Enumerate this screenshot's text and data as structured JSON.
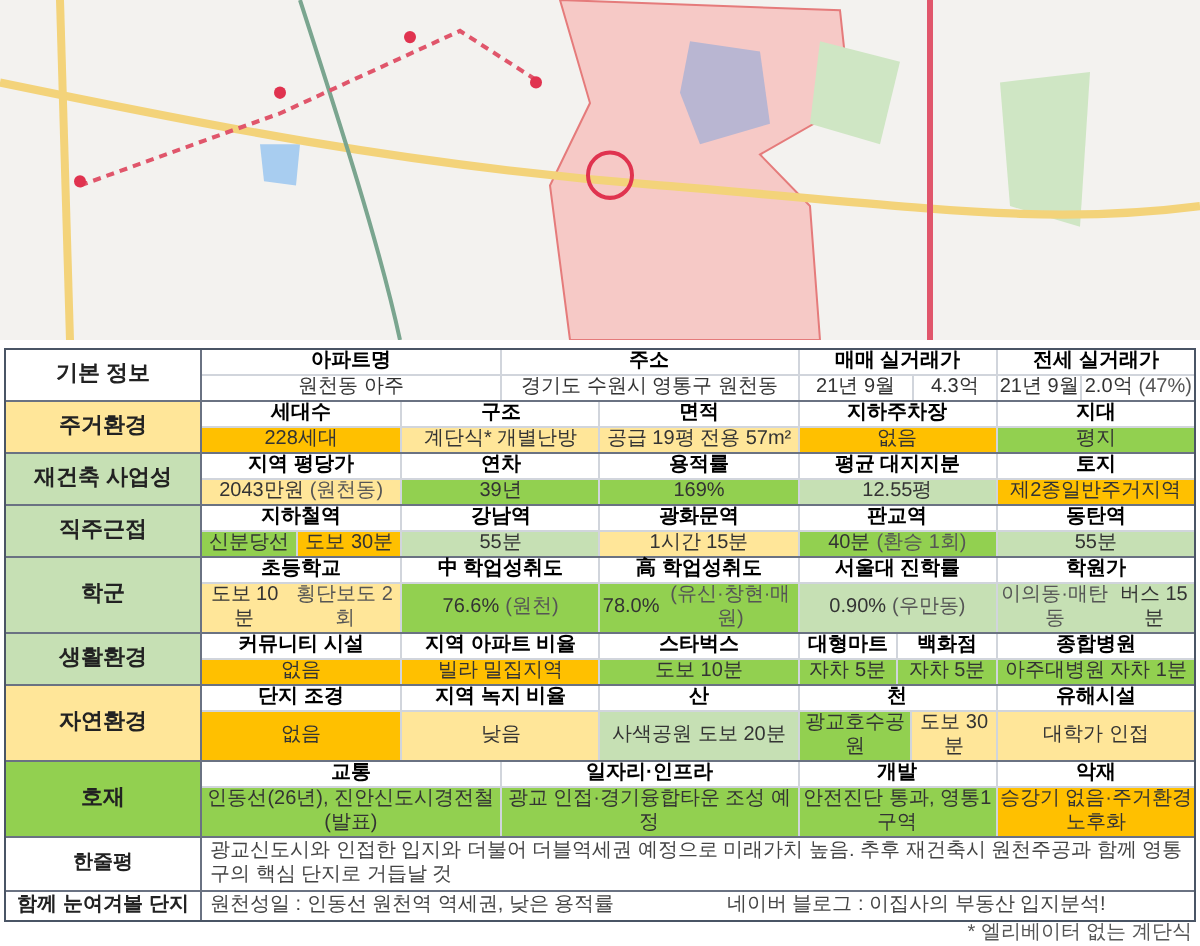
{
  "sections": [
    {
      "label": "기본 정보",
      "color": "#ffffff",
      "cells": [
        {
          "header": "아파트명",
          "values": [
            {
              "text": "원천동 아주",
              "color": "#ffffff"
            }
          ]
        },
        {
          "header": "주소",
          "values": [
            {
              "text": "경기도 수원시 영통구 원천동",
              "color": "#ffffff"
            }
          ]
        },
        {
          "header": "매매 실거래가",
          "values": [
            {
              "text": "21년 9월",
              "color": "#ffffff"
            },
            {
              "text": "4.3억",
              "color": "#ffffff"
            }
          ]
        },
        {
          "header": "전세 실거래가",
          "values": [
            {
              "text": "21년 9월",
              "color": "#ffffff"
            },
            {
              "text": "2.0억",
              "note": "(47%)",
              "color": "#ffffff"
            }
          ]
        }
      ]
    },
    {
      "label": "주거환경",
      "color": "#ffe699",
      "cells": [
        {
          "header": "세대수",
          "values": [
            {
              "text": "228세대",
              "color": "#ffc000"
            }
          ]
        },
        {
          "header": "구조",
          "values": [
            {
              "text": "계단식* 개별난방",
              "color": "#ffe699"
            }
          ]
        },
        {
          "header": "면적",
          "values": [
            {
              "text": "공급 19평 전용 57m²",
              "color": "#ffe699"
            }
          ]
        },
        {
          "header": "지하주차장",
          "values": [
            {
              "text": "없음",
              "color": "#ffc000"
            }
          ]
        },
        {
          "header": "지대",
          "values": [
            {
              "text": "평지",
              "color": "#92d050"
            }
          ]
        }
      ]
    },
    {
      "label": "재건축 사업성",
      "color": "#c6e0b4",
      "cells": [
        {
          "header": "지역 평당가",
          "values": [
            {
              "text": "2043만원",
              "note": "(원천동)",
              "color": "#ffe699"
            }
          ]
        },
        {
          "header": "연차",
          "values": [
            {
              "text": "39년",
              "color": "#92d050"
            }
          ]
        },
        {
          "header": "용적률",
          "values": [
            {
              "text": "169%",
              "color": "#92d050"
            }
          ]
        },
        {
          "header": "평균 대지지분",
          "values": [
            {
              "text": "12.55평",
              "color": "#c6e0b4"
            }
          ]
        },
        {
          "header": "토지",
          "values": [
            {
              "text": "제2종일반주거지역",
              "color": "#ffc000"
            }
          ]
        }
      ]
    },
    {
      "label": "직주근접",
      "color": "#c6e0b4",
      "cells": [
        {
          "header": "지하철역",
          "values": [
            {
              "text": "신분당선",
              "color": "#92d050"
            },
            {
              "text": "도보 30분",
              "color": "#ffc000"
            }
          ]
        },
        {
          "header": "강남역",
          "values": [
            {
              "text": "55분",
              "color": "#c6e0b4"
            }
          ]
        },
        {
          "header": "광화문역",
          "values": [
            {
              "text": "1시간 15분",
              "color": "#ffe699"
            }
          ]
        },
        {
          "header": "판교역",
          "values": [
            {
              "text": "40분",
              "note": "(환승 1회)",
              "color": "#92d050"
            }
          ]
        },
        {
          "header": "동탄역",
          "values": [
            {
              "text": "55분",
              "color": "#c6e0b4"
            }
          ]
        }
      ]
    },
    {
      "label": "학군",
      "color": "#c6e0b4",
      "cells": [
        {
          "header": "초등학교",
          "values": [
            {
              "text": "도보 10분",
              "note": "횡단보도 2회",
              "color": "#ffe699"
            }
          ]
        },
        {
          "header": "中 학업성취도",
          "values": [
            {
              "text": "76.6%",
              "note": "(원천)",
              "color": "#92d050"
            }
          ]
        },
        {
          "header": "高 학업성취도",
          "values": [
            {
              "text": "78.0%",
              "note": "(유신·창현·매원)",
              "color": "#92d050"
            }
          ]
        },
        {
          "header": "서울대 진학률",
          "values": [
            {
              "text": "0.90%",
              "note": "(우만동)",
              "color": "#c6e0b4"
            }
          ]
        },
        {
          "header": "학원가",
          "values": [
            {
              "pre": "이의동·매탄동",
              "text": "버스 15분",
              "color": "#c6e0b4"
            }
          ]
        }
      ]
    },
    {
      "label": "생활환경",
      "color": "#c6e0b4",
      "cells": [
        {
          "header": "커뮤니티 시설",
          "values": [
            {
              "text": "없음",
              "color": "#ffc000"
            }
          ]
        },
        {
          "header": "지역 아파트 비율",
          "values": [
            {
              "text": "빌라 밀집지역",
              "color": "#ffc000"
            }
          ]
        },
        {
          "header": "스타벅스",
          "values": [
            {
              "text": "도보 10분",
              "color": "#92d050"
            }
          ]
        },
        {
          "header": "대형마트",
          "values": [
            {
              "text": "자차 5분",
              "color": "#92d050"
            }
          ]
        },
        {
          "header": "백화점",
          "values": [
            {
              "text": "자차 5분",
              "color": "#92d050"
            }
          ]
        },
        {
          "header": "종합병원",
          "values": [
            {
              "text": "아주대병원 자차 1분",
              "color": "#92d050"
            }
          ]
        }
      ]
    },
    {
      "label": "자연환경",
      "color": "#ffe699",
      "cells": [
        {
          "header": "단지 조경",
          "values": [
            {
              "text": "없음",
              "color": "#ffc000"
            }
          ]
        },
        {
          "header": "지역 녹지 비율",
          "values": [
            {
              "text": "낮음",
              "color": "#ffe699"
            }
          ]
        },
        {
          "header": "산",
          "values": [
            {
              "text": "사색공원 도보 20분",
              "color": "#c6e0b4"
            }
          ]
        },
        {
          "header": "천",
          "values": [
            {
              "text": "광교호수공원",
              "color": "#92d050"
            },
            {
              "text": "도보 30분",
              "color": "#ffe699"
            }
          ]
        },
        {
          "header": "유해시설",
          "values": [
            {
              "text": "대학가 인접",
              "color": "#ffe699"
            }
          ]
        }
      ]
    },
    {
      "label": "호재",
      "color": "#92d050",
      "cells": [
        {
          "header": "교통",
          "values": [
            {
              "text": "인동선(26년), 진안신도시경전철(발표)",
              "color": "#92d050"
            }
          ]
        },
        {
          "header": "일자리·인프라",
          "values": [
            {
              "text": "광교 인접·경기융합타운 조성 예정",
              "color": "#92d050"
            }
          ]
        },
        {
          "header": "개발",
          "values": [
            {
              "text": "안전진단 통과, 영통1구역",
              "color": "#92d050"
            }
          ]
        },
        {
          "header": "악재",
          "values": [
            {
              "text": "승강기 없음·주거환경 노후화",
              "color": "#ffc000"
            }
          ]
        }
      ]
    }
  ],
  "notes": [
    {
      "label": "한줄평",
      "texts": [
        "광교신도시와 인접한 입지와 더불어 더블역세권 예정으로 미래가치 높음. 추후 재건축시 원천주공과 함께 영통구의 핵심 단지로 거듭날 것"
      ]
    },
    {
      "label": "함께 눈여겨볼 단지",
      "texts": [
        "원천성일 : 인동선 원천역 역세권, 낮은 용적률",
        "네이버 블로그 : 이집사의 부동산 입지분석!"
      ]
    }
  ],
  "footnote": "* 엘리베이터 없는 계단식"
}
